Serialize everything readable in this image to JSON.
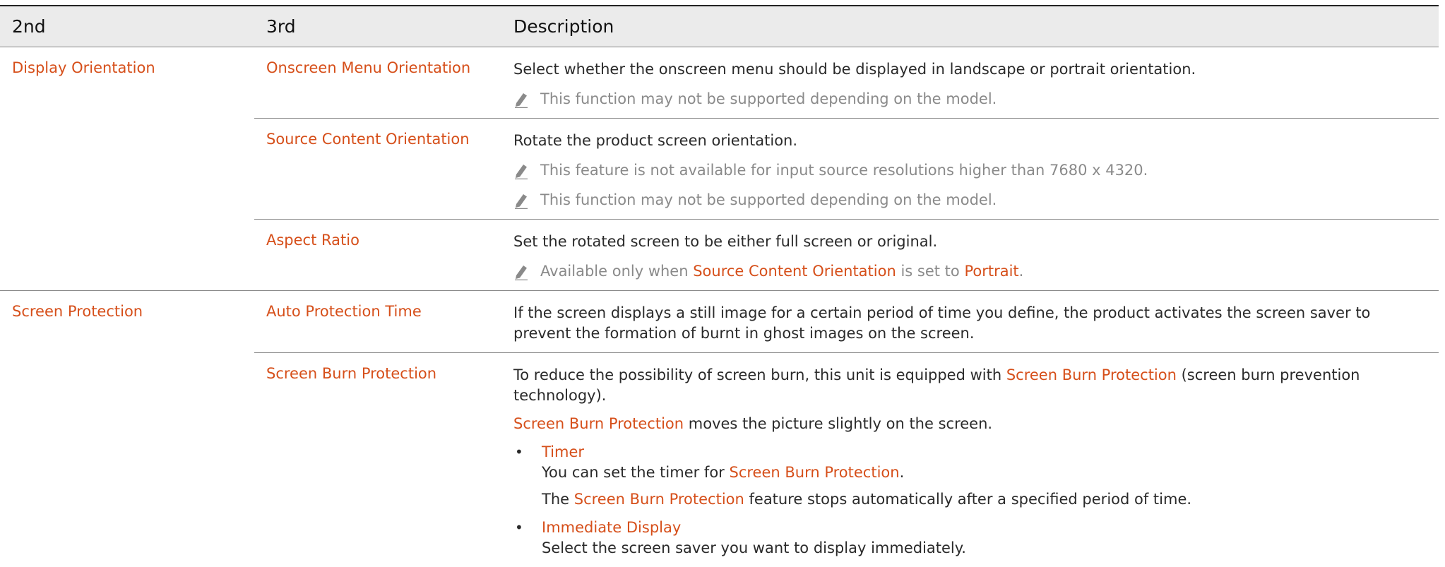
{
  "headers": {
    "col1": "2nd",
    "col2": "3rd",
    "col3": "Description"
  },
  "display_orientation": {
    "label": "Display Orientation",
    "onscreen_menu": {
      "label": "Onscreen Menu Orientation",
      "desc": "Select whether the onscreen menu should be displayed in landscape or portrait orientation.",
      "note": "This function may not be supported depending on the model."
    },
    "source_content": {
      "label": "Source Content Orientation",
      "desc": "Rotate the product screen orientation.",
      "note1": "This feature is not available for input source resolutions higher than 7680 x 4320.",
      "note2": "This function may not be supported depending on the model."
    },
    "aspect_ratio": {
      "label": "Aspect Ratio",
      "desc": "Set the rotated screen to be either full screen or original.",
      "note_pre": "Available only when ",
      "note_link1": "Source Content Orientation",
      "note_mid": " is set to ",
      "note_link2": "Portrait",
      "note_post": "."
    }
  },
  "screen_protection": {
    "label": "Screen Protection",
    "auto_protection": {
      "label": "Auto Protection Time",
      "desc": "If the screen displays a still image for a certain period of time you define, the product activates the screen saver to prevent the formation of burnt in ghost images on the screen."
    },
    "burn_protection": {
      "label": "Screen Burn Protection",
      "p1_pre": "To reduce the possibility of screen burn, this unit is equipped with ",
      "p1_link": "Screen Burn Protection",
      "p1_post": " (screen burn prevention technology).",
      "p2_link": "Screen Burn Protection",
      "p2_post": " moves the picture slightly on the screen.",
      "bullet_symbol": "•",
      "timer": {
        "title": "Timer",
        "line1_pre": "You can set the timer for ",
        "line1_link": "Screen Burn Protection",
        "line1_post": ".",
        "line2_pre": "The ",
        "line2_link": "Screen Burn Protection",
        "line2_post": " feature stops automatically after a specified period of time."
      },
      "immediate": {
        "title": "Immediate Display",
        "line1": "Select the screen saver you want to display immediately."
      }
    }
  },
  "colors": {
    "accent": "#d64f1a",
    "note": "#8a8a8a",
    "header_bg": "#ebebeb"
  },
  "note_icon": "pencil-icon"
}
